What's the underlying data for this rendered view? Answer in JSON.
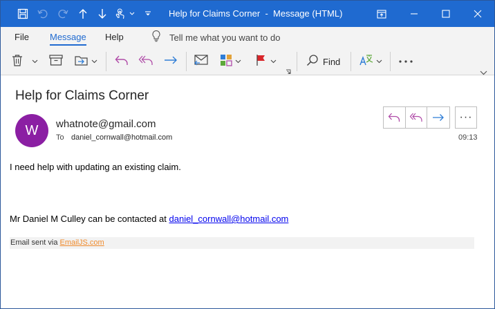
{
  "window": {
    "title": "Help for Claims Corner",
    "separator": "-",
    "message_type": "Message (HTML)"
  },
  "ribbon": {
    "tabs": [
      {
        "label": "File"
      },
      {
        "label": "Message"
      },
      {
        "label": "Help"
      }
    ],
    "active_tab": "Message",
    "tell_me": "Tell me what you want to do",
    "find_label": "Find"
  },
  "message": {
    "subject": "Help for Claims Corner",
    "avatar_initial": "W",
    "avatar_color": "#8b1fa3",
    "sender": "whatnote@gmail.com",
    "to_label": "To",
    "to_address": "daniel_cornwall@hotmail.com",
    "time": "09:13",
    "more_label": "···"
  },
  "body": {
    "line1": "I need help with updating an existing claim.",
    "contact_text": "Mr Daniel M Culley can be contacted at ",
    "contact_email": "daniel_cornwall@hotmail.com",
    "footer_text": "Email sent via ",
    "footer_link": "EmailJS.com"
  },
  "colors": {
    "titlebar": "#1f6ad0",
    "accent": "#1f6ad0",
    "reply": "#b04ca8",
    "forward": "#2e7dd6",
    "link": "#0000ee",
    "footer_link": "#f08a2b"
  }
}
